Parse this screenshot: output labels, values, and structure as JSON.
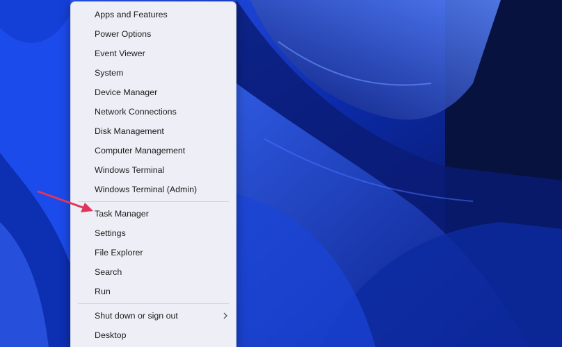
{
  "menu": {
    "items": [
      {
        "label": "Apps and Features"
      },
      {
        "label": "Power Options"
      },
      {
        "label": "Event Viewer"
      },
      {
        "label": "System"
      },
      {
        "label": "Device Manager"
      },
      {
        "label": "Network Connections"
      },
      {
        "label": "Disk Management"
      },
      {
        "label": "Computer Management"
      },
      {
        "label": "Windows Terminal"
      },
      {
        "label": "Windows Terminal (Admin)"
      },
      {
        "label": "Task Manager"
      },
      {
        "label": "Settings"
      },
      {
        "label": "File Explorer"
      },
      {
        "label": "Search"
      },
      {
        "label": "Run"
      },
      {
        "label": "Shut down or sign out",
        "submenu_icon": "chevron-right-icon"
      },
      {
        "label": "Desktop"
      }
    ]
  },
  "annotation": {
    "icon": "red-arrow-icon",
    "points_to": "Task Manager",
    "color": "#e0355a"
  },
  "colors": {
    "menu_bg": "#eeeef6",
    "wallpaper_accent": "#1f4bff"
  }
}
